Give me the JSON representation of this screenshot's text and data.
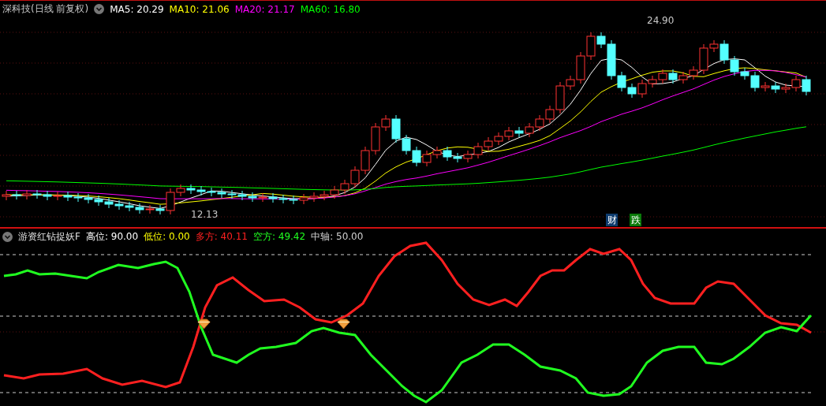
{
  "price_panel": {
    "title": "深科技(日线 前复权)",
    "legend": [
      {
        "text": "MA5: 20.29",
        "color": "#ffffff"
      },
      {
        "text": "MA10: 21.06",
        "color": "#ffff00"
      },
      {
        "text": "MA20: 21.17",
        "color": "#ff00ff"
      },
      {
        "text": "MA60: 16.80",
        "color": "#00ff00"
      }
    ],
    "high_label": "24.90",
    "low_label": "12.13",
    "badges": [
      {
        "text": "财",
        "color": "#0e3c6e"
      },
      {
        "text": "跌",
        "color": "#0a7a0a"
      }
    ]
  },
  "indicator_panel": {
    "title": "游资红钻捉妖F",
    "legend": [
      {
        "text": "高位: 90.00",
        "color": "#ffffff"
      },
      {
        "text": "低位: 0.00",
        "color": "#ffff00"
      },
      {
        "text": "多方: 40.11",
        "color": "#ff2020"
      },
      {
        "text": "空方: 49.42",
        "color": "#20ff20"
      },
      {
        "text": "中轴: 50.00",
        "color": "#d0d0d0"
      }
    ]
  }
}
